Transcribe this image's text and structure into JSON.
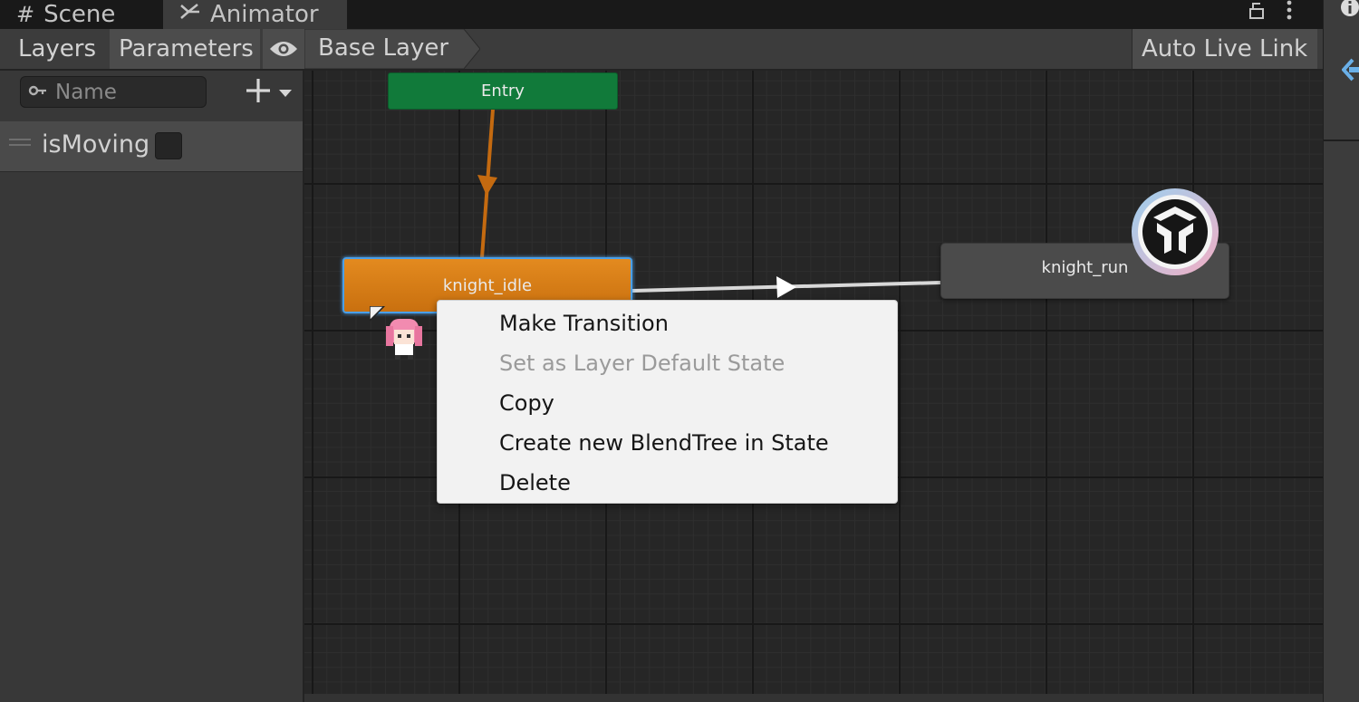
{
  "tabs": [
    {
      "label": "Scene",
      "icon": "grid-icon"
    },
    {
      "label": "Animator",
      "icon": "animator-icon"
    }
  ],
  "toolbar": {
    "layers_label": "Layers",
    "parameters_label": "Parameters",
    "eye_icon": "eye-icon",
    "breadcrumb": "Base Layer",
    "auto_live_link_label": "Auto Live Link"
  },
  "parameters": {
    "search_placeholder": "Name",
    "items": [
      {
        "name": "isMoving",
        "type": "bool",
        "checked": false
      }
    ]
  },
  "graph": {
    "states": {
      "entry": "Entry",
      "idle": "knight_idle",
      "run": "knight_run"
    },
    "colors": {
      "entry": "#117a3a",
      "default_state": "#e38a1f",
      "state": "#4b4b4b",
      "selection": "#4a9fe8",
      "default_transition": "#c46a10",
      "transition": "#d8d8d8"
    }
  },
  "context_menu": {
    "items": [
      {
        "label": "Make Transition",
        "enabled": true
      },
      {
        "label": "Set as Layer Default State",
        "enabled": false
      },
      {
        "label": "Copy",
        "enabled": true
      },
      {
        "label": "Create new BlendTree in State",
        "enabled": true
      },
      {
        "label": "Delete",
        "enabled": true
      }
    ]
  }
}
